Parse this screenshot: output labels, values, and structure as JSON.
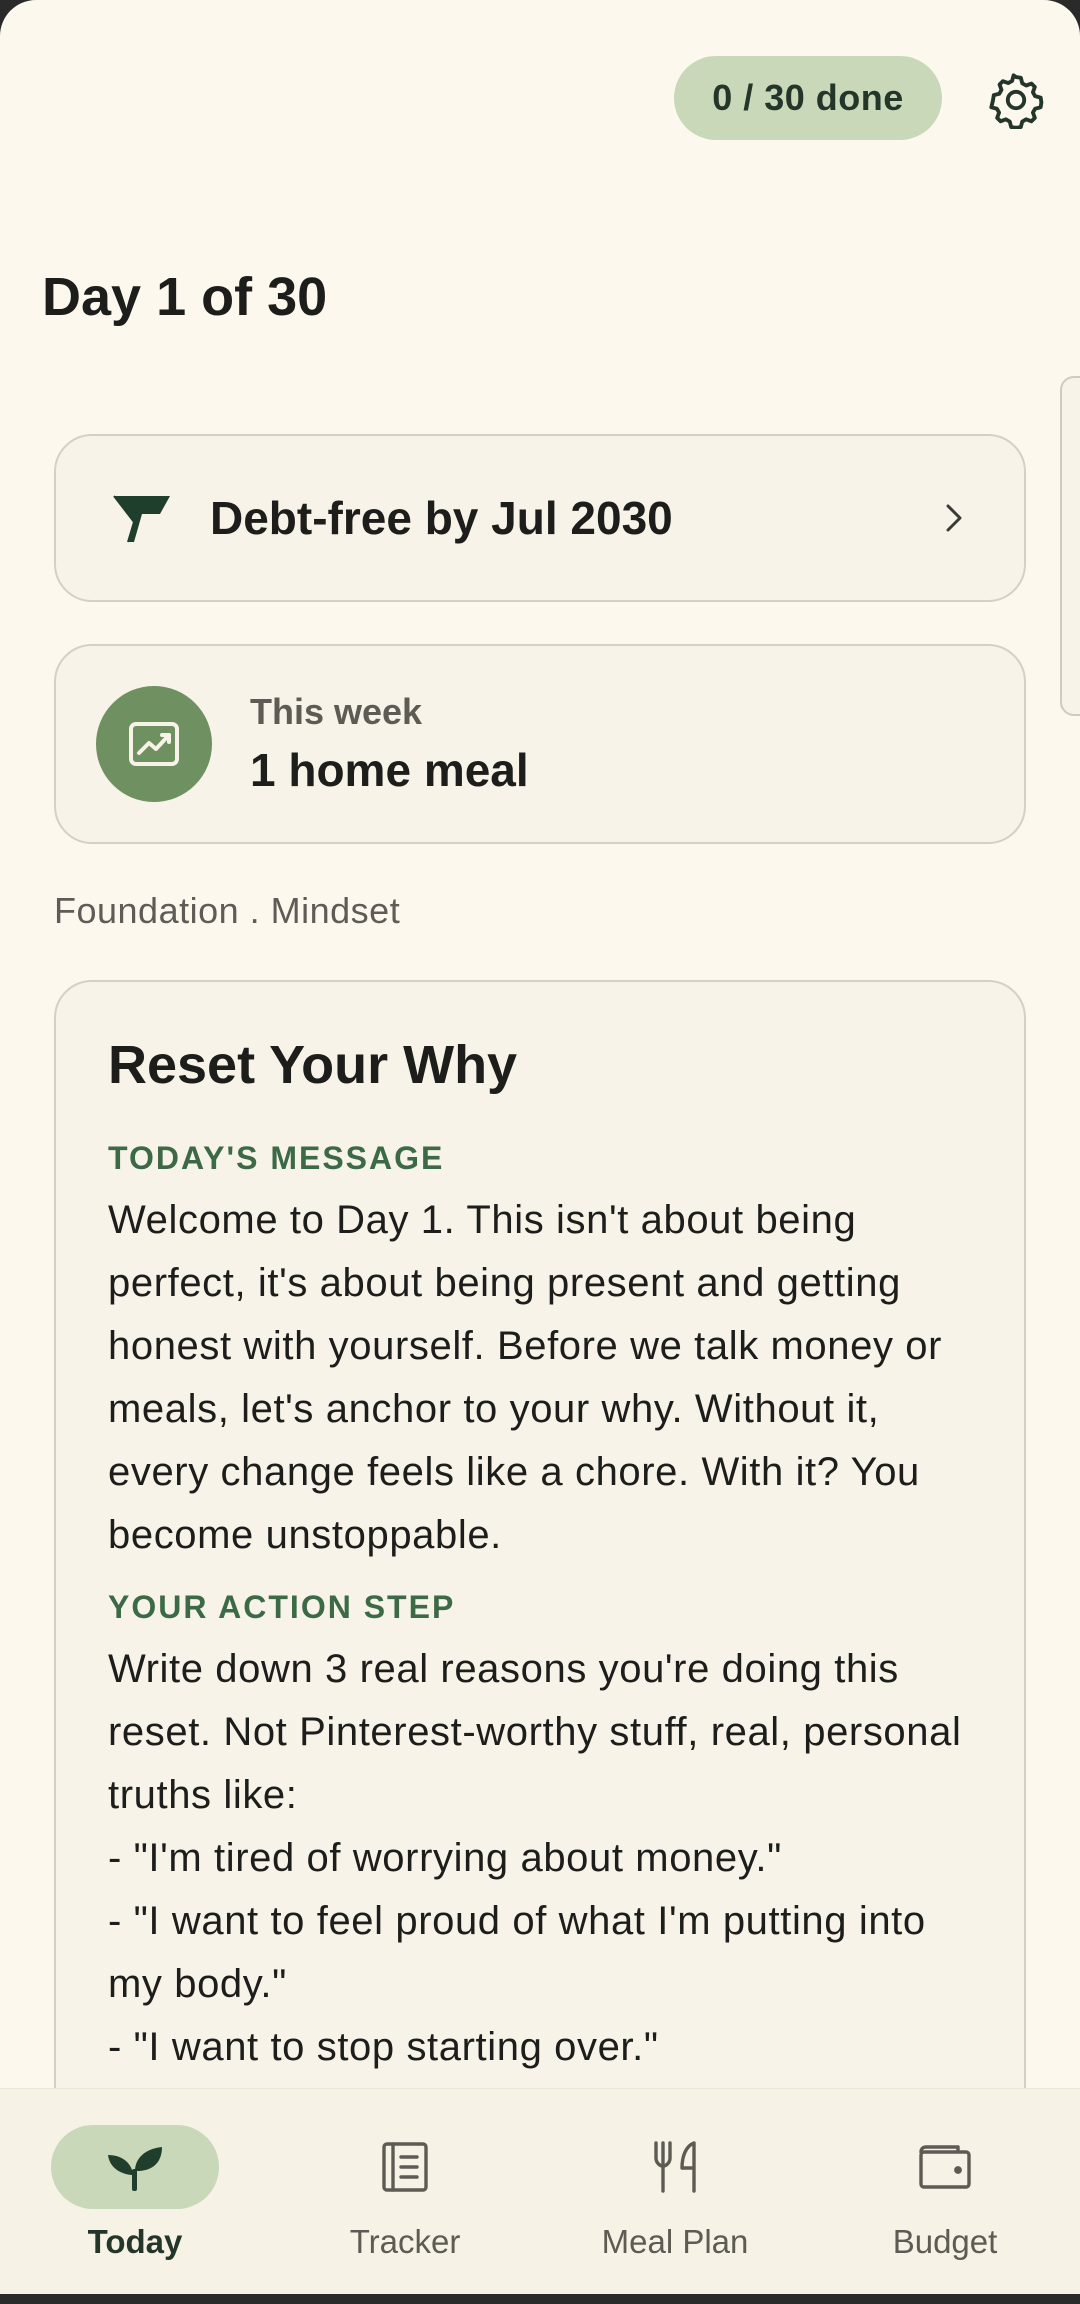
{
  "header": {
    "progress_label": "0 / 30 done",
    "settings_icon": "gear-icon"
  },
  "day_title": "Day 1 of 30",
  "goal": {
    "icon": "flag-icon",
    "text": "Debt-free by Jul 2030",
    "chevron_icon": "chevron-right-icon"
  },
  "week": {
    "icon": "trend-chart-icon",
    "label": "This week",
    "value": "1 home meal"
  },
  "section_meta": "Foundation . Mindset",
  "lesson": {
    "title": "Reset Your Why",
    "message_heading": "TODAY'S MESSAGE",
    "message_text": "Welcome to Day 1. This isn't about being perfect, it's about being present and getting honest with yourself. Before we talk money or meals, let's anchor to your why. Without it, every change feels like a chore. With it? You become unstoppable.",
    "action_heading": "YOUR ACTION STEP",
    "action_text": "Write down 3 real reasons you're doing this reset. Not Pinterest-worthy stuff, real, personal truths like:\n- \"I'm tired of worrying about money.\"\n- \"I want to feel proud of what I'm putting into my body.\"\n- \"I want to stop starting over.\""
  },
  "nav": {
    "items": [
      {
        "label": "Today",
        "icon": "sprout-icon",
        "active": true
      },
      {
        "label": "Tracker",
        "icon": "notebook-icon",
        "active": false
      },
      {
        "label": "Meal Plan",
        "icon": "fork-knife-icon",
        "active": false
      },
      {
        "label": "Budget",
        "icon": "wallet-icon",
        "active": false
      }
    ]
  },
  "colors": {
    "background": "#fcf8ee",
    "accent_pill": "#c8d8b9",
    "accent_green": "#6f9060",
    "heading_green": "#3d6a46",
    "text_dark": "#1d1d1b"
  }
}
